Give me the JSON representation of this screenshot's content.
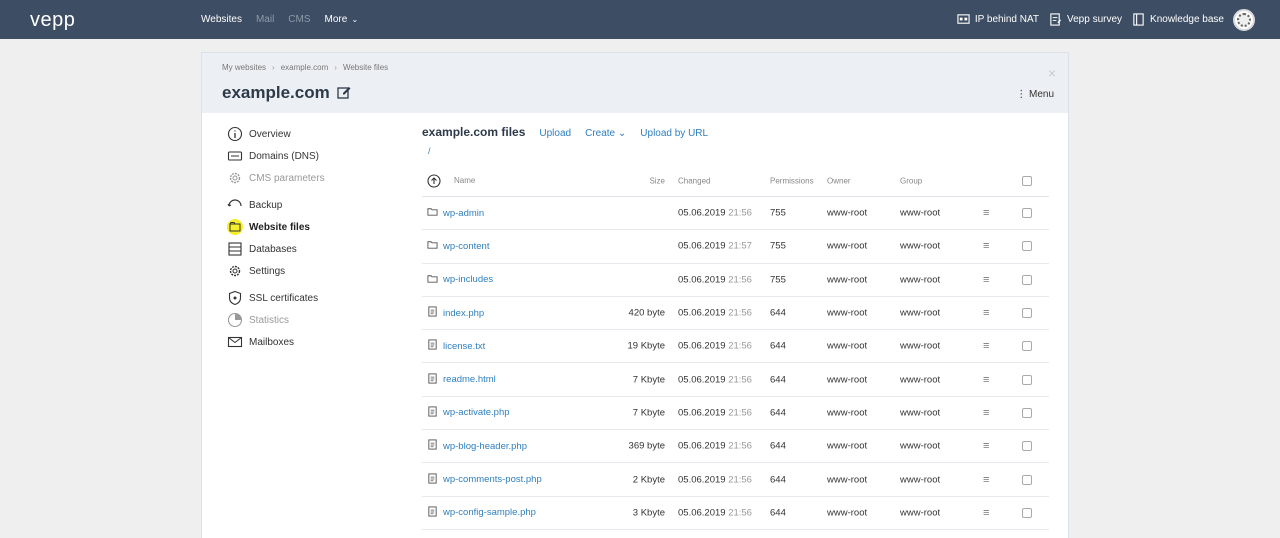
{
  "app": {
    "logo": "vepp",
    "nav": [
      {
        "label": "Websites",
        "dim": false
      },
      {
        "label": "Mail",
        "dim": true
      },
      {
        "label": "CMS",
        "dim": true
      },
      {
        "label": "More",
        "dim": false
      }
    ],
    "right_links": [
      {
        "label": "IP behind NAT",
        "icon": "network-icon"
      },
      {
        "label": "Vepp survey",
        "icon": "survey-icon"
      },
      {
        "label": "Knowledge base",
        "icon": "book-icon"
      }
    ]
  },
  "panel": {
    "breadcrumb": [
      "My websites",
      "example.com",
      "Website files"
    ],
    "title": "example.com",
    "menu_label": "Menu",
    "close_glyph": "×"
  },
  "sidebar": {
    "items": [
      {
        "label": "Overview",
        "icon": "info-icon",
        "state": "normal"
      },
      {
        "label": "Domains (DNS)",
        "icon": "dns-icon",
        "state": "normal"
      },
      {
        "label": "CMS parameters",
        "icon": "gear-icon",
        "state": "muted"
      },
      {
        "label": "Backup",
        "icon": "backup-icon",
        "state": "normal"
      },
      {
        "label": "Website files",
        "icon": "folder-icon",
        "state": "active"
      },
      {
        "label": "Databases",
        "icon": "database-icon",
        "state": "normal"
      },
      {
        "label": "Settings",
        "icon": "gear-icon",
        "state": "normal"
      },
      {
        "label": "SSL certificates",
        "icon": "shield-icon",
        "state": "normal"
      },
      {
        "label": "Statistics",
        "icon": "pie-chart-icon",
        "state": "muted"
      },
      {
        "label": "Mailboxes",
        "icon": "mail-icon",
        "state": "normal"
      }
    ]
  },
  "files": {
    "title": "example.com files",
    "actions": {
      "upload": "Upload",
      "create": "Create",
      "upload_url": "Upload by URL"
    },
    "path": "/",
    "columns": {
      "name": "Name",
      "size": "Size",
      "changed": "Changed",
      "permissions": "Permissions",
      "owner": "Owner",
      "group": "Group"
    },
    "rows": [
      {
        "type": "folder",
        "name": "wp-admin",
        "size": "",
        "date": "05.06.2019",
        "time": "21:56",
        "perm": "755",
        "owner": "www-root",
        "group": "www-root"
      },
      {
        "type": "folder",
        "name": "wp-content",
        "size": "",
        "date": "05.06.2019",
        "time": "21:57",
        "perm": "755",
        "owner": "www-root",
        "group": "www-root"
      },
      {
        "type": "folder",
        "name": "wp-includes",
        "size": "",
        "date": "05.06.2019",
        "time": "21:56",
        "perm": "755",
        "owner": "www-root",
        "group": "www-root"
      },
      {
        "type": "file",
        "name": "index.php",
        "size": "420 byte",
        "date": "05.06.2019",
        "time": "21:56",
        "perm": "644",
        "owner": "www-root",
        "group": "www-root"
      },
      {
        "type": "file",
        "name": "license.txt",
        "size": "19 Kbyte",
        "date": "05.06.2019",
        "time": "21:56",
        "perm": "644",
        "owner": "www-root",
        "group": "www-root"
      },
      {
        "type": "file",
        "name": "readme.html",
        "size": "7 Kbyte",
        "date": "05.06.2019",
        "time": "21:56",
        "perm": "644",
        "owner": "www-root",
        "group": "www-root"
      },
      {
        "type": "file",
        "name": "wp-activate.php",
        "size": "7 Kbyte",
        "date": "05.06.2019",
        "time": "21:56",
        "perm": "644",
        "owner": "www-root",
        "group": "www-root"
      },
      {
        "type": "file",
        "name": "wp-blog-header.php",
        "size": "369 byte",
        "date": "05.06.2019",
        "time": "21:56",
        "perm": "644",
        "owner": "www-root",
        "group": "www-root"
      },
      {
        "type": "file",
        "name": "wp-comments-post.php",
        "size": "2 Kbyte",
        "date": "05.06.2019",
        "time": "21:56",
        "perm": "644",
        "owner": "www-root",
        "group": "www-root"
      },
      {
        "type": "file",
        "name": "wp-config-sample.php",
        "size": "3 Kbyte",
        "date": "05.06.2019",
        "time": "21:56",
        "perm": "644",
        "owner": "www-root",
        "group": "www-root"
      }
    ]
  }
}
